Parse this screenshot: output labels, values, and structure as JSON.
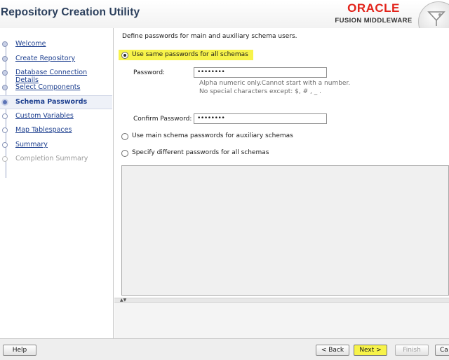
{
  "header": {
    "title": "Repository Creation Utility",
    "brand": "ORACLE",
    "brand_sub": "FUSION MIDDLEWARE"
  },
  "sidebar": {
    "steps": [
      {
        "label": "Welcome",
        "state": "done"
      },
      {
        "label": "Create Repository",
        "state": "done"
      },
      {
        "label": "Database Connection Details",
        "state": "done"
      },
      {
        "label": "Select Components",
        "state": "done"
      },
      {
        "label": "Schema Passwords",
        "state": "current"
      },
      {
        "label": "Custom Variables",
        "state": "todo"
      },
      {
        "label": "Map Tablespaces",
        "state": "todo"
      },
      {
        "label": "Summary",
        "state": "todo"
      },
      {
        "label": "Completion Summary",
        "state": "disabled"
      }
    ]
  },
  "main": {
    "instruction": "Define passwords for main and auxiliary schema users.",
    "option_same": "Use same passwords for all schemas",
    "password_label": "Password:",
    "password_value": "••••••••",
    "hint_line1": "Alpha numeric only.Cannot start with a number.",
    "hint_line2": "No special characters except: $, # , _ .",
    "confirm_label": "Confirm Password:",
    "confirm_value": "••••••••",
    "option_main": "Use main schema passwords for auxiliary schemas",
    "option_different": "Specify different passwords for all schemas"
  },
  "footer": {
    "help": "Help",
    "back": "< Back",
    "next": "Next >",
    "finish": "Finish",
    "cancel": "Ca"
  },
  "colors": {
    "highlight": "#f7f34a",
    "title": "#2b3f5c",
    "brand": "#e2231a",
    "link": "#1d3f8f"
  }
}
